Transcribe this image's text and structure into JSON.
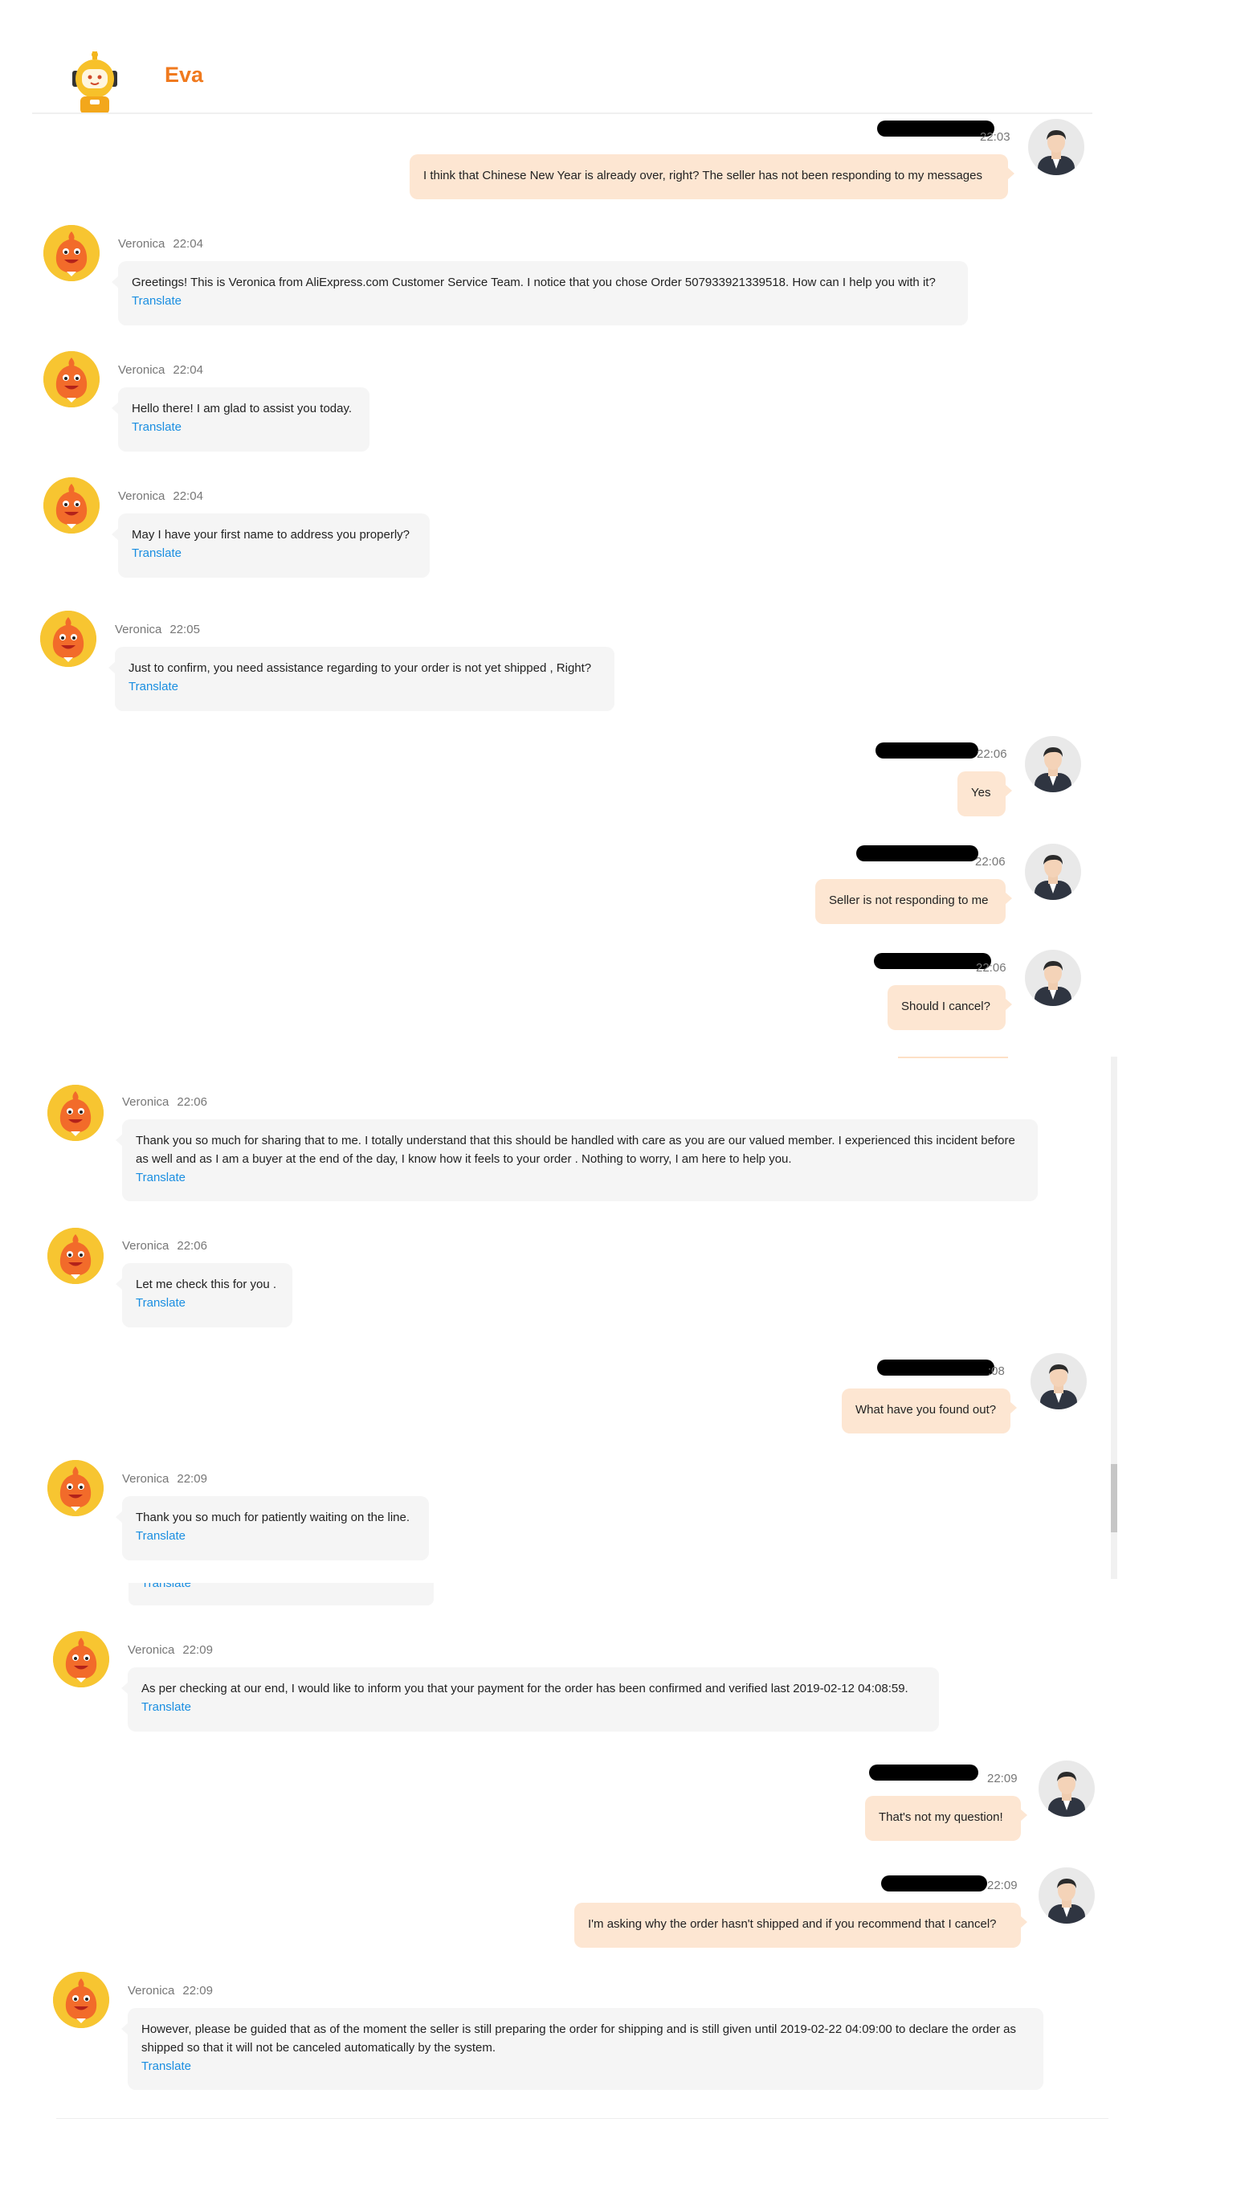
{
  "header": {
    "title": "Eva",
    "bot_icon": "robot-icon"
  },
  "colors": {
    "accent": "#f07a1e",
    "agent_bubble": "#f5f5f5",
    "user_bubble": "#fde6d2",
    "link": "#1a8ee1"
  },
  "messages": [
    {
      "sender": "user",
      "name": "",
      "time": "22:03",
      "text": "I think that Chinese New Year is already over, right? The seller has not been responding to my messages"
    },
    {
      "sender": "agent",
      "name": "Veronica",
      "time": "22:04",
      "text": "Greetings! This is Veronica from AliExpress.com Customer Service Team. I notice that you chose Order 507933921339518. How can I help you with it?",
      "translate": "Translate"
    },
    {
      "sender": "agent",
      "name": "Veronica",
      "time": "22:04",
      "text": "Hello there! I am glad to assist you today.",
      "translate": "Translate"
    },
    {
      "sender": "agent",
      "name": "Veronica",
      "time": "22:04",
      "text": "May I have your first name to address you properly?",
      "translate": "Translate"
    },
    {
      "sender": "agent",
      "name": "Veronica",
      "time": "22:05",
      "text": "Just to confirm, you need assistance regarding to your order is not yet shipped , Right?",
      "translate": "Translate"
    },
    {
      "sender": "user",
      "name": "",
      "time": "22:06",
      "text": "Yes"
    },
    {
      "sender": "user",
      "name": "",
      "time": "22:06",
      "text": "Seller is not responding to me"
    },
    {
      "sender": "user",
      "name": "",
      "time": "22:06",
      "text": "Should I cancel?"
    },
    {
      "sender": "agent",
      "name": "Veronica",
      "time": "22:06",
      "text": "Thank you so much for sharing that to me. I totally understand that this should be handled with care as you are our valued member. I experienced this incident before as well and as I am a buyer at the end of the day, I know how it feels to your order . Nothing to worry, I am here to help you.",
      "translate": "Translate"
    },
    {
      "sender": "agent",
      "name": "Veronica",
      "time": "22:06",
      "text": "Let me check this for you .",
      "translate": "Translate"
    },
    {
      "sender": "user",
      "name": "",
      "time": ":08",
      "text": "What have you found out?"
    },
    {
      "sender": "agent",
      "name": "Veronica",
      "time": "22:09",
      "text": "Thank you so much for patiently waiting on the line.",
      "translate": "Translate"
    },
    {
      "sender": "agent",
      "name": "Veronica",
      "time": "22:09",
      "text": "As per checking at our end, I would like to inform you that your payment for the order has been confirmed and verified last 2019-02-12 04:08:59.",
      "translate": "Translate"
    },
    {
      "sender": "user",
      "name": "",
      "time": "22:09",
      "text": "That's not my question!"
    },
    {
      "sender": "user",
      "name": "",
      "time": "22:09",
      "text": "I'm asking why the order hasn't shipped and if you recommend that I cancel?"
    },
    {
      "sender": "agent",
      "name": "Veronica",
      "time": "22:09",
      "text": "However, please be guided that as of the moment the seller is still preparing the order for shipping and is still given until 2019-02-22 04:09:00 to declare the order as shipped so that it will not be canceled automatically by the system.",
      "translate": "Translate"
    }
  ],
  "ghost_translate": "Translate"
}
